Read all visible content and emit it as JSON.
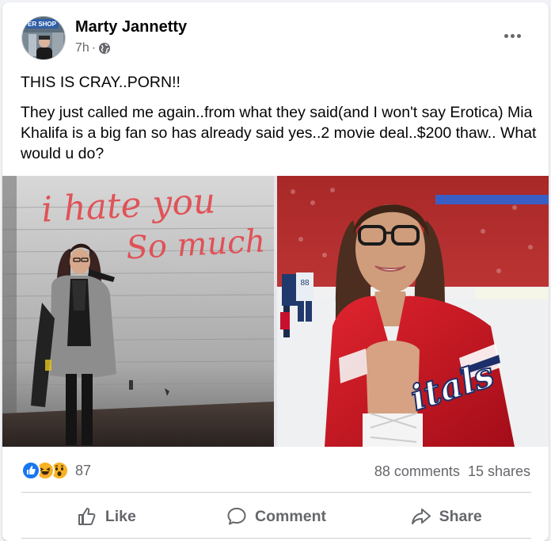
{
  "post": {
    "author": "Marty Jannetty",
    "avatar_sign_text": "ER SHOP",
    "time": "7h",
    "separator": "·",
    "more_icon": "more-horizontal-icon",
    "privacy_icon": "globe-icon",
    "text_line1": "THIS IS CRAY..PORN!!",
    "text_line2": "They just called me again..from what they said(and I won't say Erotica) Mia Khalifa is a big fan so has already said yes..2 movie deal..$200 thaw.. What would u do?"
  },
  "photos": {
    "left": {
      "graffiti_line1": "i hate you",
      "graffiti_line2": "So much"
    },
    "right": {
      "jacket_text": "itals",
      "jersey_number": "88"
    }
  },
  "engagement": {
    "reactions": [
      "like-reaction-icon",
      "haha-reaction-icon",
      "wow-reaction-icon"
    ],
    "reaction_count": "87",
    "comments": "88 comments",
    "shares": "15 shares"
  },
  "actions": {
    "like_label": "Like",
    "comment_label": "Comment",
    "share_label": "Share"
  },
  "colors": {
    "facebook_blue": "#1877f2",
    "secondary_text": "#65676b",
    "graffiti_red": "#e2464c",
    "caps_red": "#c8102e"
  }
}
